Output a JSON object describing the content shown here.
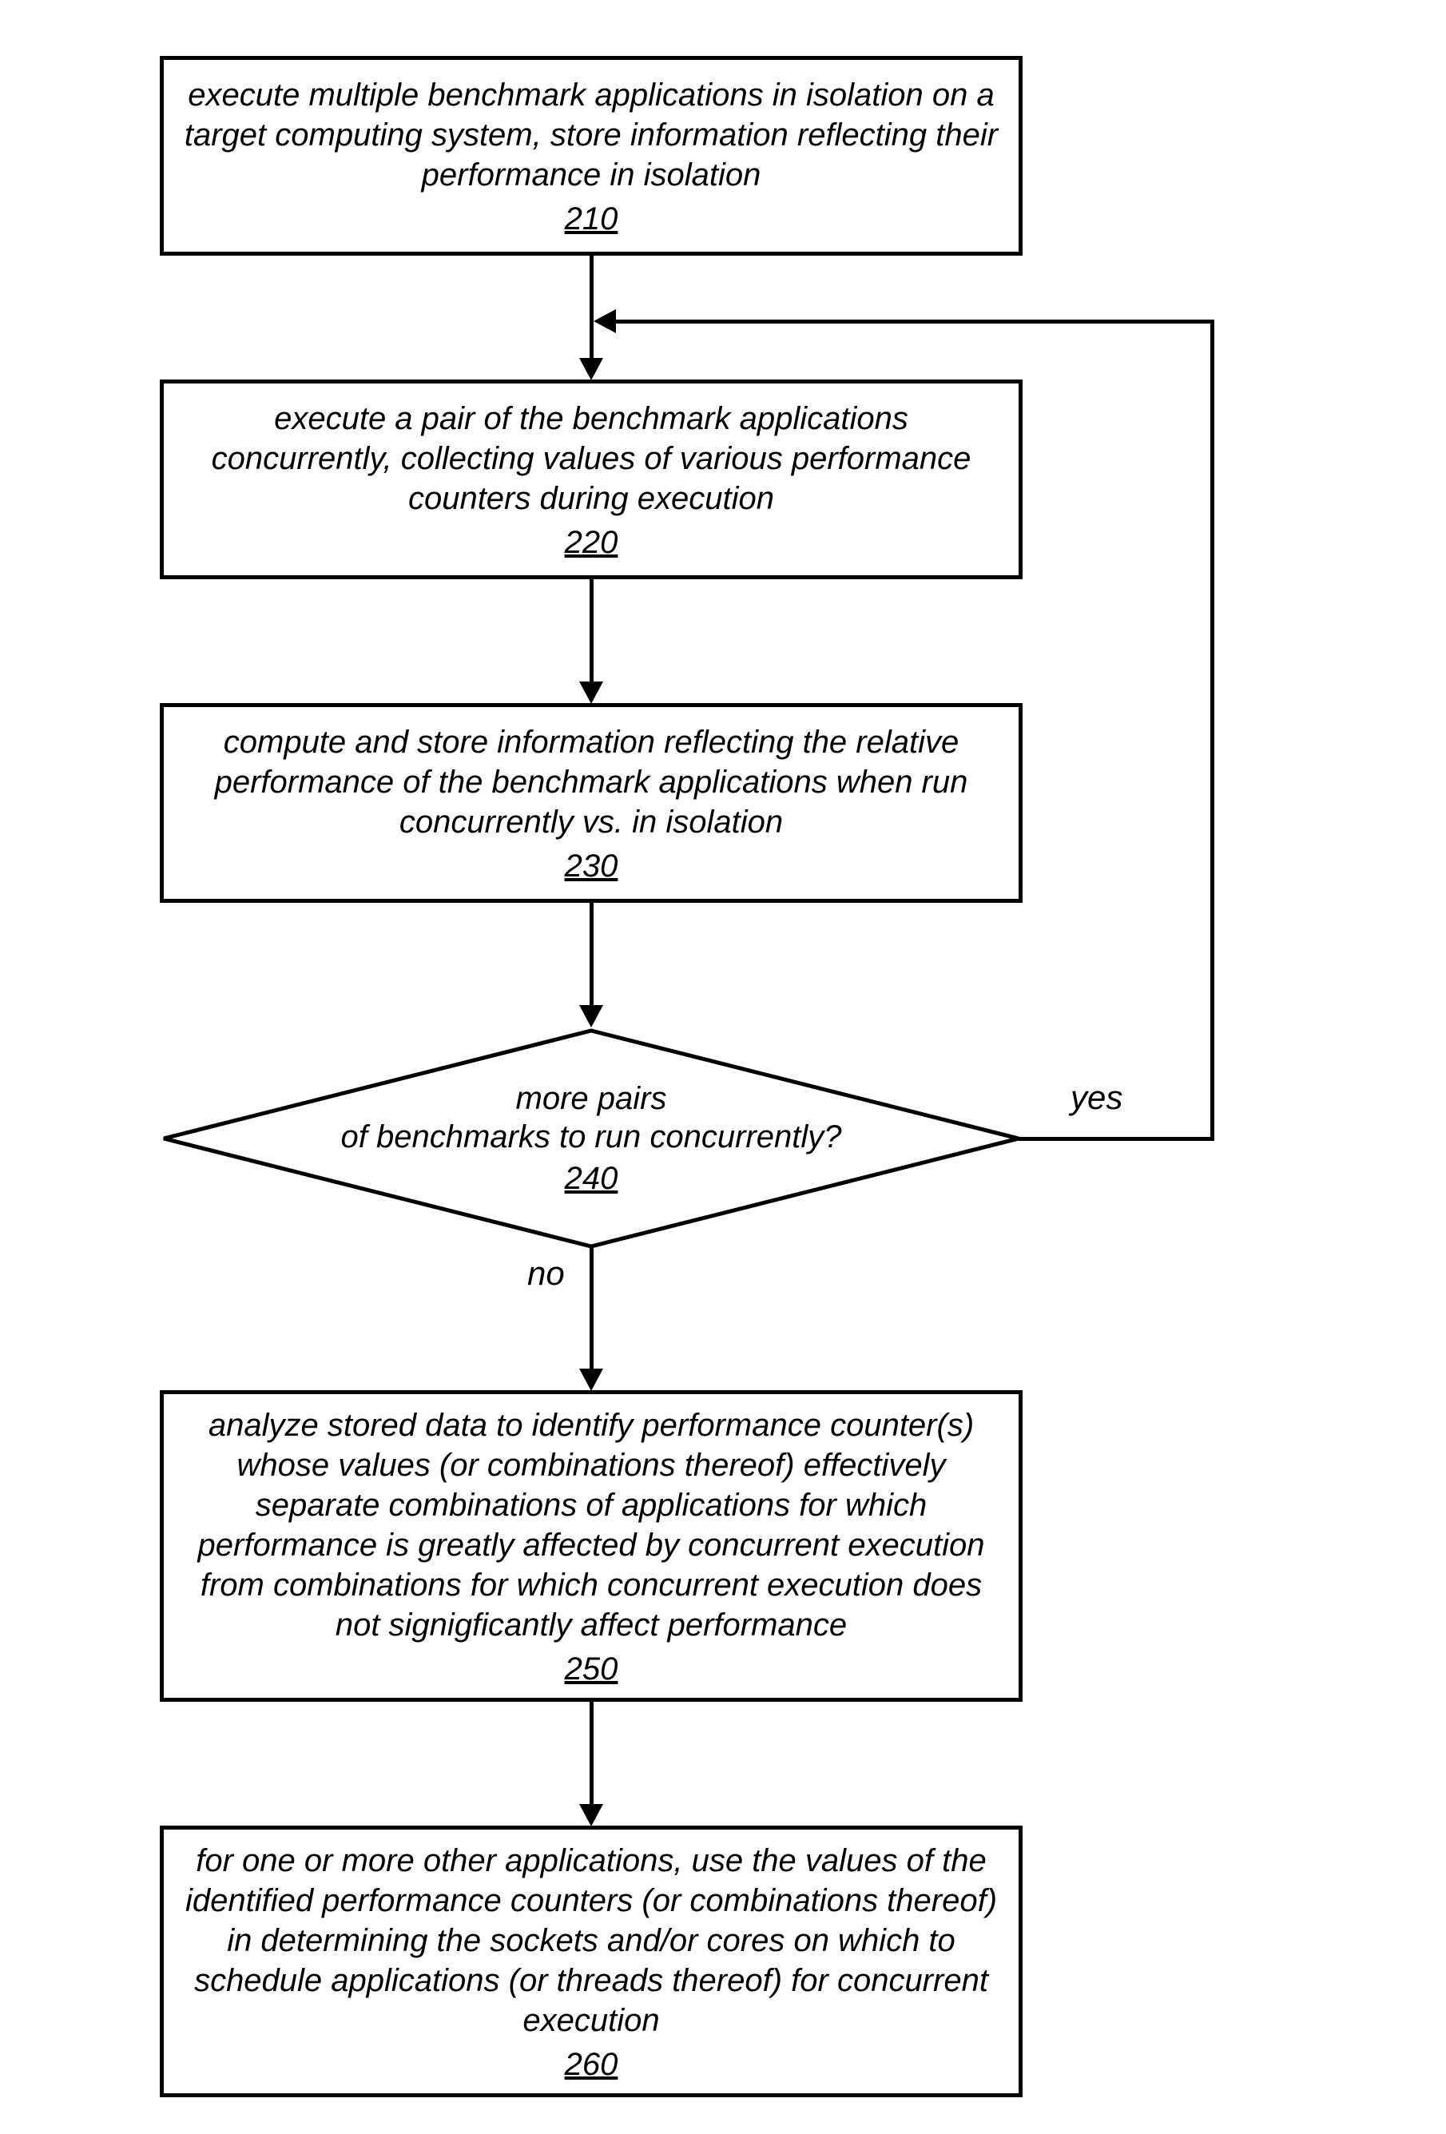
{
  "boxes": {
    "b210": {
      "text": "execute multiple benchmark applications in isolation on a target computing system, store information reflecting their performance in isolation",
      "num": "210"
    },
    "b220": {
      "text": "execute a pair of the benchmark applications concurrently, collecting values of various performance counters during execution",
      "num": "220"
    },
    "b230": {
      "text": "compute and store information reflecting the relative performance of the benchmark applications when run concurrently vs. in isolation",
      "num": "230"
    },
    "b240": {
      "line1": "more pairs",
      "line2": "of benchmarks to run concurrently?",
      "num": "240"
    },
    "b250": {
      "text": "analyze stored data to identify performance counter(s) whose values (or combinations thereof) effectively separate combinations of applications for which performance is greatly affected by concurrent execution from combinations for which concurrent execution does not signigficantly affect performance",
      "num": "250"
    },
    "b260": {
      "text": "for one or more other applications, use the values of the identified performance counters (or combinations thereof) in determining the sockets and/or cores on which to schedule applications (or threads thereof) for concurrent execution",
      "num": "260"
    }
  },
  "labels": {
    "yes": "yes",
    "no": "no"
  }
}
